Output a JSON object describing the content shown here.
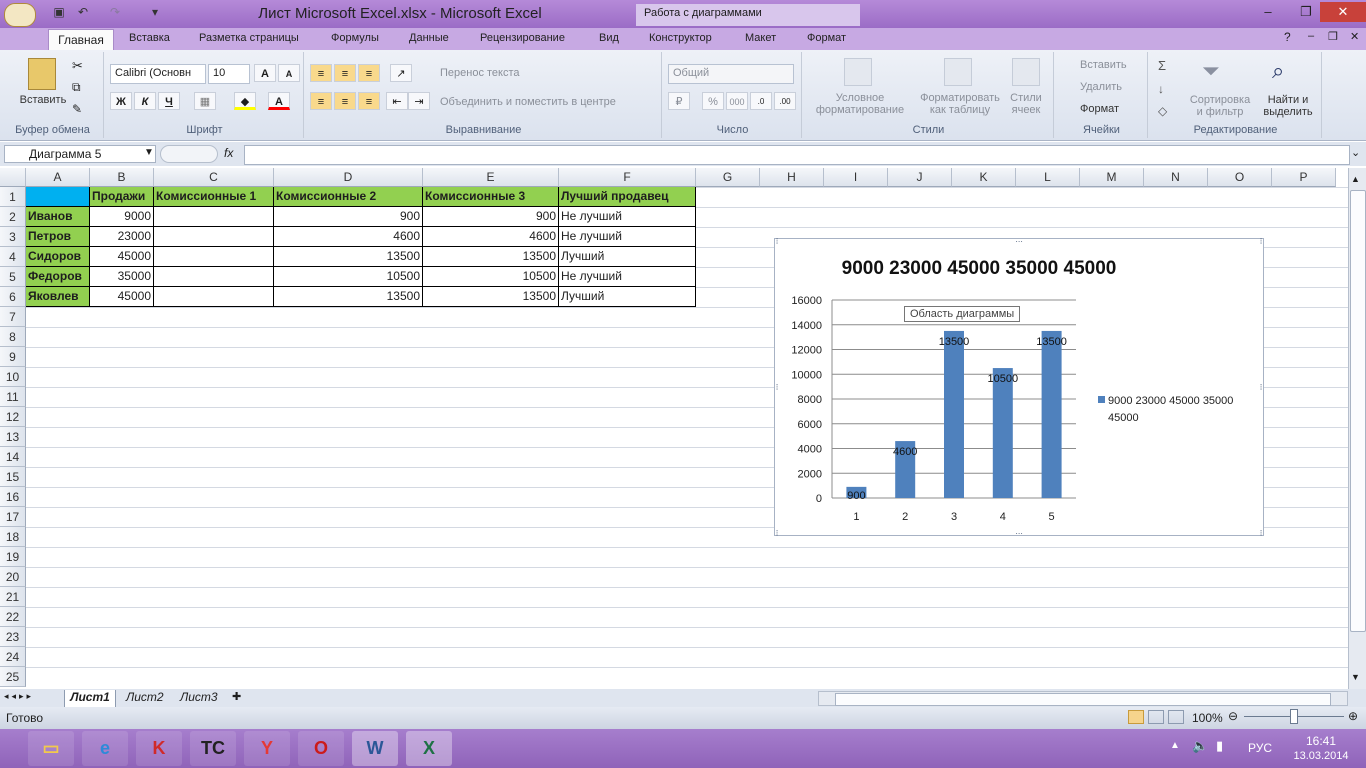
{
  "window": {
    "title": "Лист Microsoft Excel.xlsx - Microsoft Excel",
    "context_tab": "Работа с диаграммами"
  },
  "tabs": [
    "Главная",
    "Вставка",
    "Разметка страницы",
    "Формулы",
    "Данные",
    "Рецензирование",
    "Вид",
    "Конструктор",
    "Макет",
    "Формат"
  ],
  "ribbon": {
    "clipboard": {
      "paste_label": "Вставить",
      "group": "Буфер обмена"
    },
    "font": {
      "name": "Calibri (Основн",
      "size": "10",
      "bold": "Ж",
      "italic": "К",
      "underline": "Ч",
      "group": "Шрифт"
    },
    "alignment": {
      "wrap": "Перенос текста",
      "merge": "Объединить и поместить в центре",
      "group": "Выравнивание"
    },
    "number": {
      "format": "Общий",
      "percent": "%",
      "thousands": "000",
      "group": "Число"
    },
    "styles": {
      "conditional_line1": "Условное",
      "conditional_line2": "форматирование",
      "table_line1": "Форматировать",
      "table_line2": "как таблицу",
      "cell_line1": "Стили",
      "cell_line2": "ячеек",
      "group": "Стили"
    },
    "cells": {
      "insert": "Вставить",
      "delete": "Удалить",
      "format": "Формат",
      "group": "Ячейки"
    },
    "editing": {
      "sort_line1": "Сортировка",
      "sort_line2": "и фильтр",
      "find_line1": "Найти и",
      "find_line2": "выделить",
      "group": "Редактирование"
    }
  },
  "formula_bar": {
    "name_box": "Диаграмма 5",
    "fx": "fx",
    "formula": ""
  },
  "columns": [
    "A",
    "B",
    "C",
    "D",
    "E",
    "F",
    "G",
    "H",
    "I",
    "J",
    "K",
    "L",
    "M",
    "N",
    "O",
    "P"
  ],
  "rows": [
    "1",
    "2",
    "3",
    "4",
    "5",
    "6",
    "7",
    "8",
    "9",
    "10",
    "11",
    "12",
    "13",
    "14",
    "15",
    "16",
    "17",
    "18",
    "19",
    "20",
    "21",
    "22",
    "23",
    "24",
    "25"
  ],
  "table": {
    "headers": [
      "",
      "Продажи",
      "Комиссионные 1",
      "Комиссионные 2",
      "Комиссионные 3",
      "Лучший продавец"
    ],
    "data": [
      [
        "Иванов",
        "9000",
        "",
        "900",
        "900",
        "Не лучший"
      ],
      [
        "Петров",
        "23000",
        "",
        "4600",
        "4600",
        "Не лучший"
      ],
      [
        "Сидоров",
        "45000",
        "",
        "13500",
        "13500",
        "Лучший"
      ],
      [
        "Федоров",
        "35000",
        "",
        "10500",
        "10500",
        "Не лучший"
      ],
      [
        "Яковлев",
        "45000",
        "",
        "13500",
        "13500",
        "Лучший"
      ]
    ]
  },
  "chart_data": {
    "type": "bar",
    "title": "9000 23000 45000 35000 45000",
    "categories": [
      "1",
      "2",
      "3",
      "4",
      "5"
    ],
    "series": [
      {
        "name": "9000 23000 45000 35000 45000",
        "values": [
          900,
          4600,
          13500,
          10500,
          13500
        ]
      }
    ],
    "data_labels": [
      "900",
      "4600",
      "13500",
      "10500",
      "13500"
    ],
    "ylim": [
      0,
      16000
    ],
    "yticks": [
      0,
      2000,
      4000,
      6000,
      8000,
      10000,
      12000,
      14000,
      16000
    ],
    "legend_position": "right",
    "grid": true,
    "bar_color": "#4f81bd",
    "legend_line1": "9000 23000 45000 35000",
    "legend_line2": "45000"
  },
  "tooltip": "Область диаграммы",
  "sheets": [
    "Лист1",
    "Лист2",
    "Лист3"
  ],
  "status": {
    "ready": "Готово",
    "zoom": "100%"
  },
  "taskbar": {
    "lang": "РУС",
    "time": "16:41",
    "date": "13.03.2014",
    "apps": [
      {
        "icon": "file-explorer-icon",
        "glyph": "▭",
        "color": "#f2c94c"
      },
      {
        "icon": "internet-explorer-icon",
        "glyph": "e",
        "color": "#2d8ad8"
      },
      {
        "icon": "kaspersky-icon",
        "glyph": "K",
        "color": "#d02a2a"
      },
      {
        "icon": "total-commander-icon",
        "glyph": "TC",
        "color": "#222222"
      },
      {
        "icon": "yandex-browser-icon",
        "glyph": "Y",
        "color": "#e53935"
      },
      {
        "icon": "opera-icon",
        "glyph": "O",
        "color": "#cc1b1b"
      },
      {
        "icon": "word-icon",
        "glyph": "W",
        "color": "#2b5797"
      },
      {
        "icon": "excel-icon",
        "glyph": "X",
        "color": "#1e7145"
      }
    ]
  }
}
